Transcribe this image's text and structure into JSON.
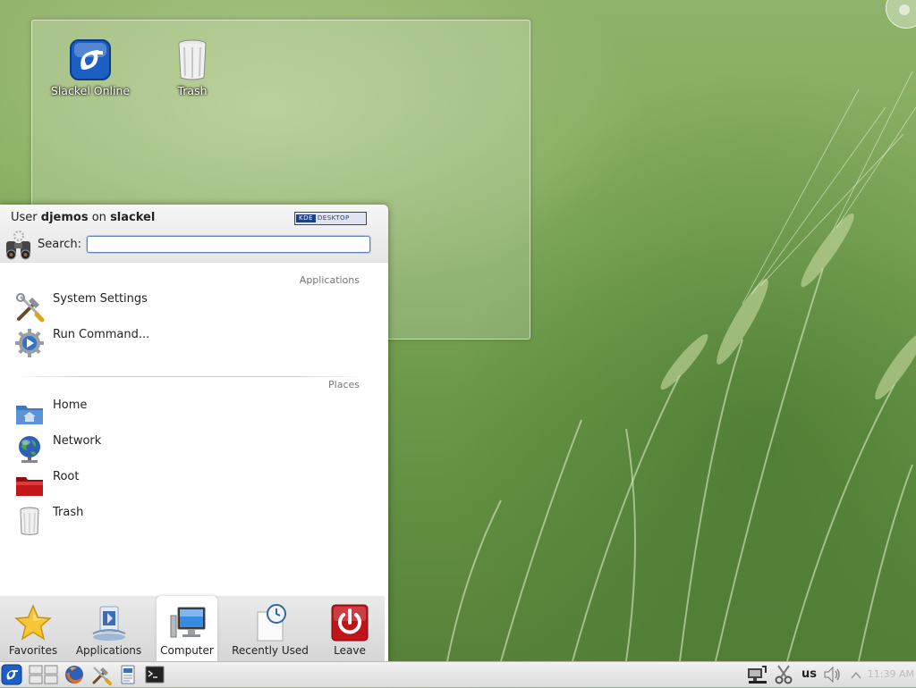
{
  "desktop": {
    "icons": [
      {
        "label": "Slackel Online",
        "icon": "slackel-icon"
      },
      {
        "label": "Trash",
        "icon": "trash-icon"
      }
    ]
  },
  "kickoff": {
    "user_prefix": "User",
    "user_name": "djemos",
    "user_on": "on",
    "host_name": "slackel",
    "logo_kde": "KDE",
    "logo_desktop": "DESKTOP",
    "search_label": "Search:",
    "search_value": "",
    "sections": {
      "applications": "Applications",
      "places": "Places"
    },
    "applications": [
      {
        "label": "System Settings",
        "icon": "tools-icon"
      },
      {
        "label": "Run Command...",
        "icon": "run-gear-icon"
      }
    ],
    "places": [
      {
        "label": "Home",
        "icon": "home-folder-icon"
      },
      {
        "label": "Network",
        "icon": "network-globe-icon"
      },
      {
        "label": "Root",
        "icon": "root-folder-icon"
      },
      {
        "label": "Trash",
        "icon": "trash-icon"
      }
    ],
    "tabs": [
      {
        "label": "Favorites",
        "icon": "star-icon"
      },
      {
        "label": "Applications",
        "icon": "applications-icon"
      },
      {
        "label": "Computer",
        "icon": "computer-icon",
        "active": true
      },
      {
        "label": "Recently Used",
        "icon": "clock-document-icon"
      },
      {
        "label": "Leave",
        "icon": "power-icon"
      }
    ]
  },
  "panel": {
    "launchers": [
      "slackel-menu-icon",
      "pager-icon",
      "firefox-icon",
      "settings-tools-icon",
      "file-manager-icon",
      "terminal-icon"
    ],
    "tray": {
      "keyboard_layout": "us",
      "clock": "11:39 AM"
    }
  },
  "colors": {
    "accent": "#1d3f86",
    "leave_red": "#c0141b",
    "search_border": "#5e7fb8"
  }
}
